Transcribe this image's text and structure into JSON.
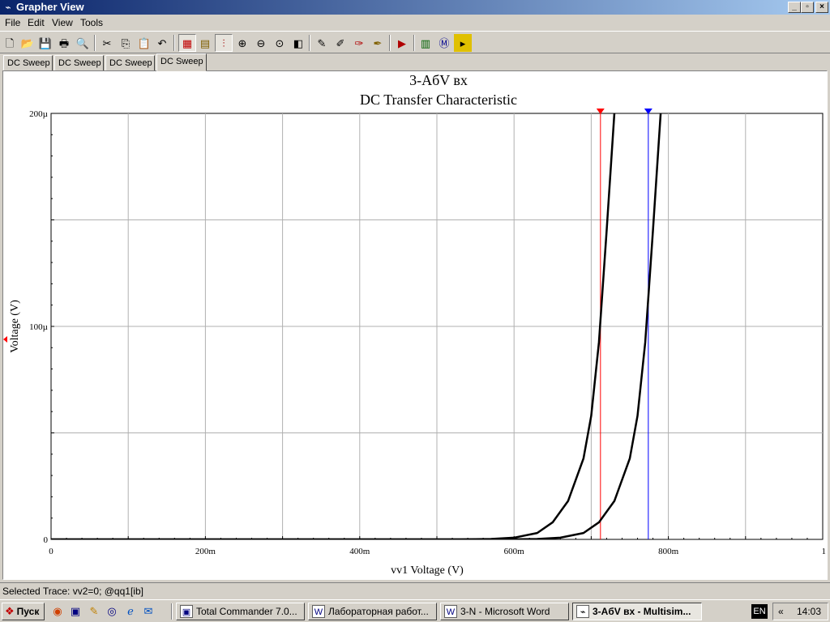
{
  "window": {
    "title": "Grapher View",
    "controls": [
      "_",
      "▫",
      "×"
    ]
  },
  "menu": [
    "File",
    "Edit",
    "View",
    "Tools"
  ],
  "toolbar": [
    "new-icon",
    "open-icon",
    "save-icon",
    "print-icon",
    "print-preview-icon",
    "|",
    "cut-icon",
    "copy-icon",
    "paste-icon",
    "undo-icon",
    "|",
    "grid-toggle-icon",
    "legend-toggle-icon",
    "cursors-toggle-icon",
    "zoom-in-icon",
    "zoom-out-icon",
    "zoom-fit-icon",
    "overlay-traces-icon",
    "|",
    "properties-icon",
    "select-marks-icon",
    "reverse-colors-icon",
    "restore-icon",
    "|",
    "export-icon",
    "|",
    "export-to-excel-icon",
    "export-to-mathcad-icon",
    "export-to-labview-icon"
  ],
  "tabs": [
    "DC Sweep",
    "DC Sweep",
    "DC Sweep",
    "DC Sweep"
  ],
  "active_tab": 3,
  "chart_data": {
    "type": "line",
    "title": "3-AбV вх",
    "subtitle": "DC Transfer Characteristic",
    "xlabel": "vv1 Voltage (V)",
    "ylabel": "Voltage (V)",
    "xlim": [
      0,
      1
    ],
    "ylim": [
      0,
      0.0002
    ],
    "x_tick_labels": [
      "0",
      "200m",
      "400m",
      "600m",
      "800m",
      "1"
    ],
    "y_tick_labels": [
      "0",
      "100µ",
      "200µ"
    ],
    "grid": true,
    "series": [
      {
        "color": "#000000",
        "x": [
          0,
          0.53,
          0.57,
          0.6,
          0.63,
          0.65,
          0.67,
          0.69,
          0.7,
          0.71,
          0.72,
          0.73
        ],
        "y": [
          0,
          0,
          2e-07,
          8e-07,
          3e-06,
          8e-06,
          1.8e-05,
          3.8e-05,
          5.8e-05,
          9.25e-05,
          0.000145,
          0.0002
        ]
      },
      {
        "color": "#000000",
        "x": [
          0,
          0.59,
          0.63,
          0.66,
          0.69,
          0.71,
          0.73,
          0.75,
          0.76,
          0.77,
          0.78,
          0.79
        ],
        "y": [
          0,
          0,
          2e-07,
          8e-07,
          3e-06,
          8e-06,
          1.8e-05,
          3.8e-05,
          5.8e-05,
          9.25e-05,
          0.000145,
          0.0002
        ]
      }
    ],
    "cursors": [
      {
        "x": 0.712,
        "color": "#ff0000"
      },
      {
        "x": 0.774,
        "color": "#0000ff"
      }
    ]
  },
  "status": {
    "selected_trace": "Selected Trace:  vv2=0; @qq1[ib]"
  },
  "taskbar": {
    "start_label": "Пуск",
    "tasks": [
      "Total Commander 7.0...",
      "Лабораторная работ...",
      "3-N - Microsoft Word",
      "3-AбV вх - Multisim..."
    ],
    "active_task": 3,
    "language": "EN",
    "tray_arrows": "«",
    "clock": "14:03"
  }
}
